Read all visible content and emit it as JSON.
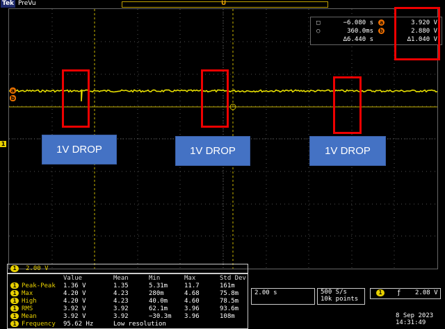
{
  "header": {
    "logo": "Tek",
    "status": "PreVu",
    "trigger_marker": "U"
  },
  "cursor_readout": {
    "rows": [
      {
        "symbol": "□",
        "time": "−6.080 s",
        "tag": "a",
        "value": "3.920 V"
      },
      {
        "symbol": "○",
        "time": "360.0ms",
        "tag": "b",
        "value": "2.880 V"
      },
      {
        "symbol": "",
        "time": "∆6.440 s",
        "tag": "",
        "value": "∆1.040 V"
      }
    ]
  },
  "annotations": [
    "1V DROP",
    "1V DROP",
    "1V DROP"
  ],
  "markers": {
    "channel": "1",
    "ref_a": "a",
    "ref_b": "b"
  },
  "channel_scale": {
    "channel": "1",
    "scale": "2.00 V"
  },
  "measurements": {
    "headers": [
      "Value",
      "Mean",
      "Min",
      "Max",
      "Std Dev"
    ],
    "rows": [
      {
        "badge": "1",
        "name": "Peak-Peak",
        "cols": [
          "1.36 V",
          "1.35",
          "5.31m",
          "11.7",
          "161m"
        ]
      },
      {
        "badge": "1",
        "name": "Max",
        "cols": [
          "4.20 V",
          "4.23",
          "280m",
          "4.68",
          "75.8m"
        ]
      },
      {
        "badge": "1",
        "name": "High",
        "cols": [
          "4.20 V",
          "4.23",
          "40.0m",
          "4.60",
          "78.5m"
        ]
      },
      {
        "badge": "1",
        "name": "RMS",
        "cols": [
          "3.92 V",
          "3.92",
          "62.1m",
          "3.96",
          "93.6m"
        ]
      },
      {
        "badge": "1",
        "name": "Mean",
        "cols": [
          "3.92 V",
          "3.92",
          "−30.3m",
          "3.96",
          "108m"
        ]
      },
      {
        "badge": "1",
        "name": "Frequency",
        "cols": [
          "95.62 Hz",
          "Low resolution",
          "",
          "",
          ""
        ]
      }
    ]
  },
  "timebase": {
    "scale": "2.00 s"
  },
  "acquisition": {
    "rate": "500 S/s",
    "points": "10k points"
  },
  "trigger": {
    "channel": "1",
    "slope": "ƒ",
    "level": "2.08 V"
  },
  "datetime": {
    "date": "8 Sep  2023",
    "time": "14:31:49"
  },
  "colors": {
    "trace": "#e8e000",
    "cursor": "#c8b400",
    "highlight": "#e00000",
    "callout": "#4472c4"
  }
}
